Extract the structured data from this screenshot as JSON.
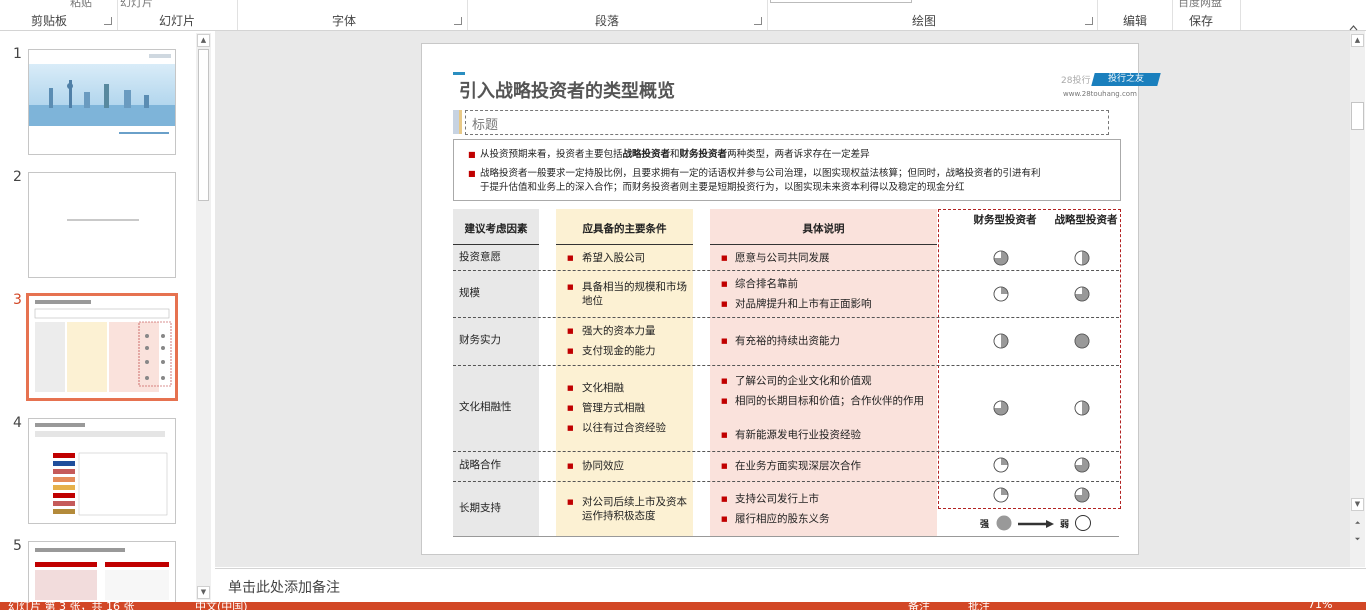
{
  "ribbon": {
    "groups": [
      {
        "label": "剪贴板"
      },
      {
        "label": "幻灯片"
      },
      {
        "label": "字体"
      },
      {
        "label": "段落"
      },
      {
        "label": "绘图"
      },
      {
        "label": "编辑"
      },
      {
        "label": "保存"
      }
    ],
    "cut_texts": [
      "幻灯片",
      "百度网盘"
    ]
  },
  "thumbnails": {
    "numbers": [
      "1",
      "2",
      "3",
      "4",
      "5"
    ],
    "selected_index": 3
  },
  "slide": {
    "title": "引入战略投资者的类型概览",
    "logo": {
      "prefix": "28投行",
      "tag": "投行之友",
      "url": "www.28touhang.com"
    },
    "heading_placeholder": "标题",
    "intro": [
      {
        "pre": "从投资预期来看，投资者主要包括",
        "b1": "战略投资者",
        "mid": "和",
        "b2": "财务投资者",
        "post": "两种类型，两者诉求存在一定差异"
      },
      {
        "line1": "战略投资者一般要求一定持股比例，且要求拥有一定的话语权并参与公司治理，以图实现权益法核算；但同时，战略投资者的引进有利",
        "line2": "于提升估值和业务上的深入合作；而财务投资者则主要是短期投资行为，以图实现未来资本利得以及稳定的现金分红"
      }
    ],
    "table": {
      "headers": [
        "建议考虑因素",
        "应具备的主要条件",
        "具体说明",
        "财务型投资者",
        "战略型投资者"
      ],
      "rows": [
        {
          "factor": "投资意愿",
          "conditions": [
            "希望入股公司"
          ],
          "details": [
            "愿意与公司共同发展"
          ],
          "fin": 0.75,
          "str": 0.5
        },
        {
          "factor": "规模",
          "conditions": [
            "具备相当的规模和市场地位"
          ],
          "details": [
            "综合排名靠前",
            "对品牌提升和上市有正面影响"
          ],
          "fin": 0.25,
          "str": 0.75
        },
        {
          "factor": "财务实力",
          "conditions": [
            "强大的资本力量",
            "支付现金的能力"
          ],
          "details": [
            "有充裕的持续出资能力"
          ],
          "fin": 0.5,
          "str": 1.0
        },
        {
          "factor": "文化相融性",
          "conditions": [
            "文化相融",
            "管理方式相融",
            "以往有过合资经验"
          ],
          "details": [
            "了解公司的企业文化和价值观",
            "相同的长期目标和价值；合作伙伴的作用",
            "有新能源发电行业投资经验"
          ],
          "fin": 0.75,
          "str": 0.5
        },
        {
          "factor": "战略合作",
          "conditions": [
            "协同效应"
          ],
          "details": [
            "在业务方面实现深层次合作"
          ],
          "fin": 0.25,
          "str": 0.75
        },
        {
          "factor": "长期支持",
          "conditions": [
            "对公司后续上市及资本运作持积极态度"
          ],
          "details": [
            "支持公司发行上市",
            "履行相应的股东义务"
          ],
          "fin": 0.25,
          "str": 0.75
        }
      ],
      "legend": {
        "strong": "强",
        "weak": "弱"
      }
    }
  },
  "notes_placeholder": "单击此处添加备注",
  "status": {
    "slide_info": "幻灯片 第 3 张，共 16 张",
    "lang": "中文(中国)",
    "notes": "备注",
    "comments": "批注",
    "zoom": "71%"
  },
  "colors": {
    "accent": "#d24726",
    "conditions_bg": "#fcf1d3",
    "details_bg": "#fae2dc",
    "factor_bg": "#e8e8e8"
  }
}
